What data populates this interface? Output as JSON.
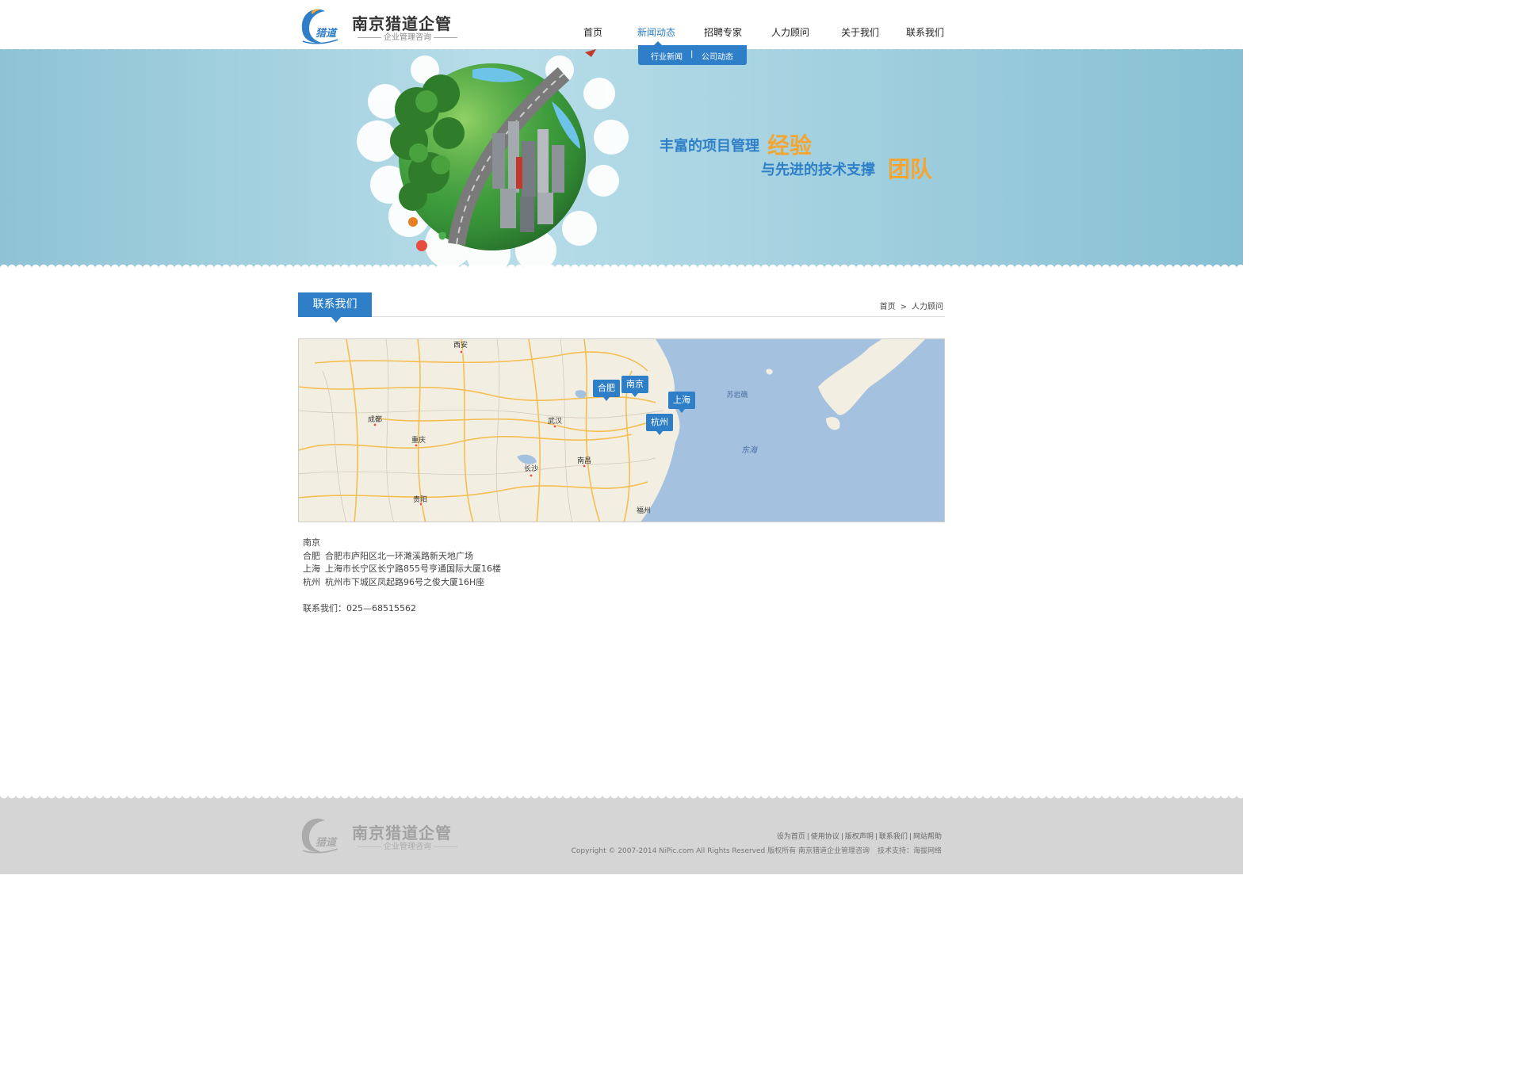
{
  "colors": {
    "accent": "#2e7fc8",
    "slogan_highlight": "#f4a531",
    "banner_sky": "#a9d4e2",
    "footer_bg": "#d5d5d5",
    "sea": "#a4c2df"
  },
  "header": {
    "logo_mark": "猎道",
    "logo_title": "南京猎道企管",
    "logo_subtitle": "企业管理咨询",
    "nav": [
      {
        "label": "首页",
        "active": false
      },
      {
        "label": "新闻动态",
        "active": true
      },
      {
        "label": "招聘专家",
        "active": false
      },
      {
        "label": "人力顾问",
        "active": false
      },
      {
        "label": "关于我们",
        "active": false
      },
      {
        "label": "联系我们",
        "active": false
      }
    ],
    "subnav": {
      "items": [
        "行业新闻",
        "公司动态"
      ],
      "separator": "|"
    }
  },
  "banner": {
    "line1_text": "丰富的项目管理",
    "line1_highlight": "经验",
    "line2_text": "与先进的技术支撑",
    "line2_highlight": "团队"
  },
  "section": {
    "title": "联系我们",
    "breadcrumb": {
      "home": "首页",
      "separator": ">",
      "current": "人力顾问"
    }
  },
  "map": {
    "cities": [
      "西安",
      "成都",
      "重庆",
      "武汉",
      "长沙",
      "南昌",
      "贵阳",
      "福州",
      "苏岩礁"
    ],
    "sea_label": "东海",
    "markers": [
      "合肥",
      "南京",
      "上海",
      "杭州"
    ]
  },
  "addresses": [
    {
      "city": "南京",
      "address": ""
    },
    {
      "city": "合肥",
      "address": "合肥市庐阳区北一环濉溪路新天地广场"
    },
    {
      "city": "上海",
      "address": "上海市长宁区长宁路855号亨通国际大厦16楼"
    },
    {
      "city": "杭州",
      "address": "杭州市下城区凤起路96号之俊大厦16H座"
    }
  ],
  "contact": {
    "label": "联系我们：",
    "phone": "025—68515562"
  },
  "footer": {
    "logo_title": "南京猎道企管",
    "logo_subtitle": "企业管理咨询",
    "links": [
      "设为首页",
      "使用协议",
      "版权声明",
      "联系我们",
      "网站帮助"
    ],
    "link_separator": "|",
    "copyright": "Copyright © 2007-2014 NiPic.com All Rights Reserved 版权所有 南京猎道企业管理咨询",
    "tech_support": "技术支持：海拔网络"
  }
}
